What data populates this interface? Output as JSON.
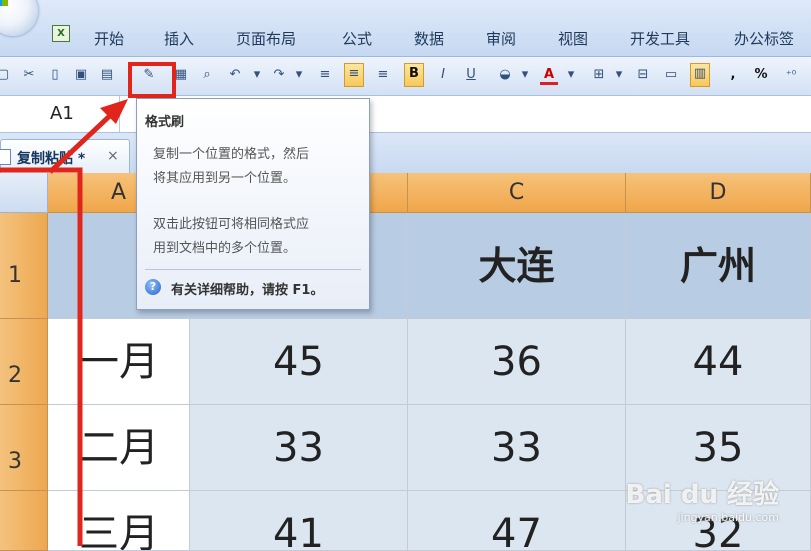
{
  "app": {
    "ribbon_tabs": [
      "开始",
      "插入",
      "页面布局",
      "公式",
      "数据",
      "审阅",
      "视图",
      "开发工具",
      "办公标签"
    ],
    "excel_icon_glyph": "X",
    "name_box": "A1"
  },
  "toolbar": {
    "bold_label": "B",
    "italic_label": "I",
    "underline_label": "U",
    "percent_label": "%",
    "comma_label": ","
  },
  "tooltip": {
    "title": "格式刷",
    "line1": "复制一个位置的格式，然后",
    "line2": "将其应用到另一个位置。",
    "line3": "双击此按钮可将相同格式应",
    "line4": "用到文档中的多个位置。",
    "help_icon": "?",
    "help_text": "有关详细帮助，请按 F1。"
  },
  "document_tab": {
    "label": "复制粘贴 *",
    "close_glyph": "×"
  },
  "sheet": {
    "columns": [
      "A",
      "C",
      "D"
    ],
    "rows": [
      "1",
      "2",
      "3"
    ],
    "header_row": {
      "c": "大连",
      "d": "广州"
    },
    "data_rows": [
      {
        "month": "一月",
        "b": "45",
        "c": "36",
        "d": "44"
      },
      {
        "month": "二月",
        "b": "33",
        "c": "33",
        "d": "35"
      },
      {
        "month": "三月",
        "b": "41",
        "c": "47",
        "d": "32"
      }
    ]
  },
  "colors": {
    "highlight": "#e0261c",
    "header_orange": "#f0a64a",
    "cell_blue": "#dce6f1",
    "header_cell_blue": "#b8cce4"
  },
  "watermark": {
    "logo": "Bai du 经验",
    "url": "jingyan.baidu.com"
  }
}
